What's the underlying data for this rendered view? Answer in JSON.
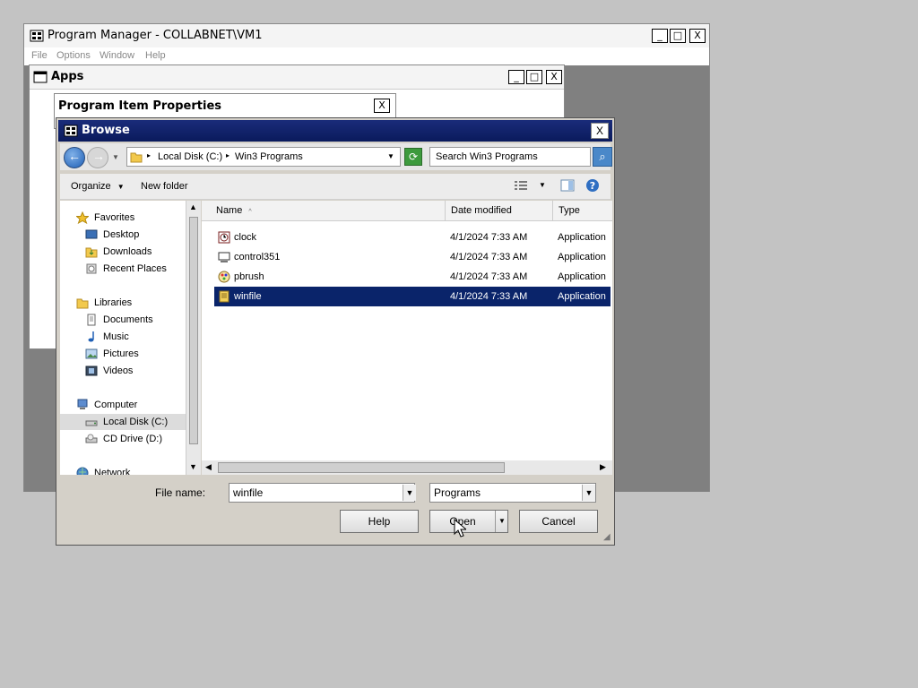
{
  "progman": {
    "title": "Program Manager - COLLABNET\\VM1",
    "menu": [
      "File",
      "Options",
      "Window",
      "Help"
    ],
    "controls": [
      "_",
      "□",
      "X"
    ]
  },
  "apps": {
    "title": "Apps",
    "controls": [
      "_",
      "□",
      "X"
    ]
  },
  "pip": {
    "title": "Program Item Properties",
    "close": "X"
  },
  "browse": {
    "title": "Browse",
    "close": "X",
    "breadcrumb": [
      "Local Disk (C:)",
      "Win3 Programs"
    ],
    "search_placeholder": "Search Win3 Programs",
    "organize_label": "Organize",
    "new_folder_label": "New folder",
    "nav": {
      "favorites": {
        "label": "Favorites",
        "items": [
          "Desktop",
          "Downloads",
          "Recent Places"
        ]
      },
      "libraries": {
        "label": "Libraries",
        "items": [
          "Documents",
          "Music",
          "Pictures",
          "Videos"
        ]
      },
      "computer": {
        "label": "Computer",
        "items": [
          "Local Disk (C:)",
          "CD Drive (D:)"
        ]
      },
      "network": {
        "label": "Network"
      }
    },
    "columns": {
      "name": "Name",
      "date": "Date modified",
      "type": "Type"
    },
    "files": [
      {
        "name": "clock",
        "date": "4/1/2024 7:33 AM",
        "type": "Application",
        "icon": "clock-app-icon"
      },
      {
        "name": "control351",
        "date": "4/1/2024 7:33 AM",
        "type": "Application",
        "icon": "control-panel-icon"
      },
      {
        "name": "pbrush",
        "date": "4/1/2024 7:33 AM",
        "type": "Application",
        "icon": "paintbrush-icon"
      },
      {
        "name": "winfile",
        "date": "4/1/2024 7:33 AM",
        "type": "Application",
        "icon": "file-manager-icon",
        "selected": true
      }
    ],
    "file_name_label": "File name:",
    "file_name_value": "winfile",
    "file_type_value": "Programs",
    "help_label": "Help",
    "open_label": "Open",
    "cancel_label": "Cancel"
  },
  "colors": {
    "selection": "#0a246a",
    "title_bar": "#0a1a5c",
    "desktop": "#c3c3c3",
    "mdi_client": "#808080"
  }
}
